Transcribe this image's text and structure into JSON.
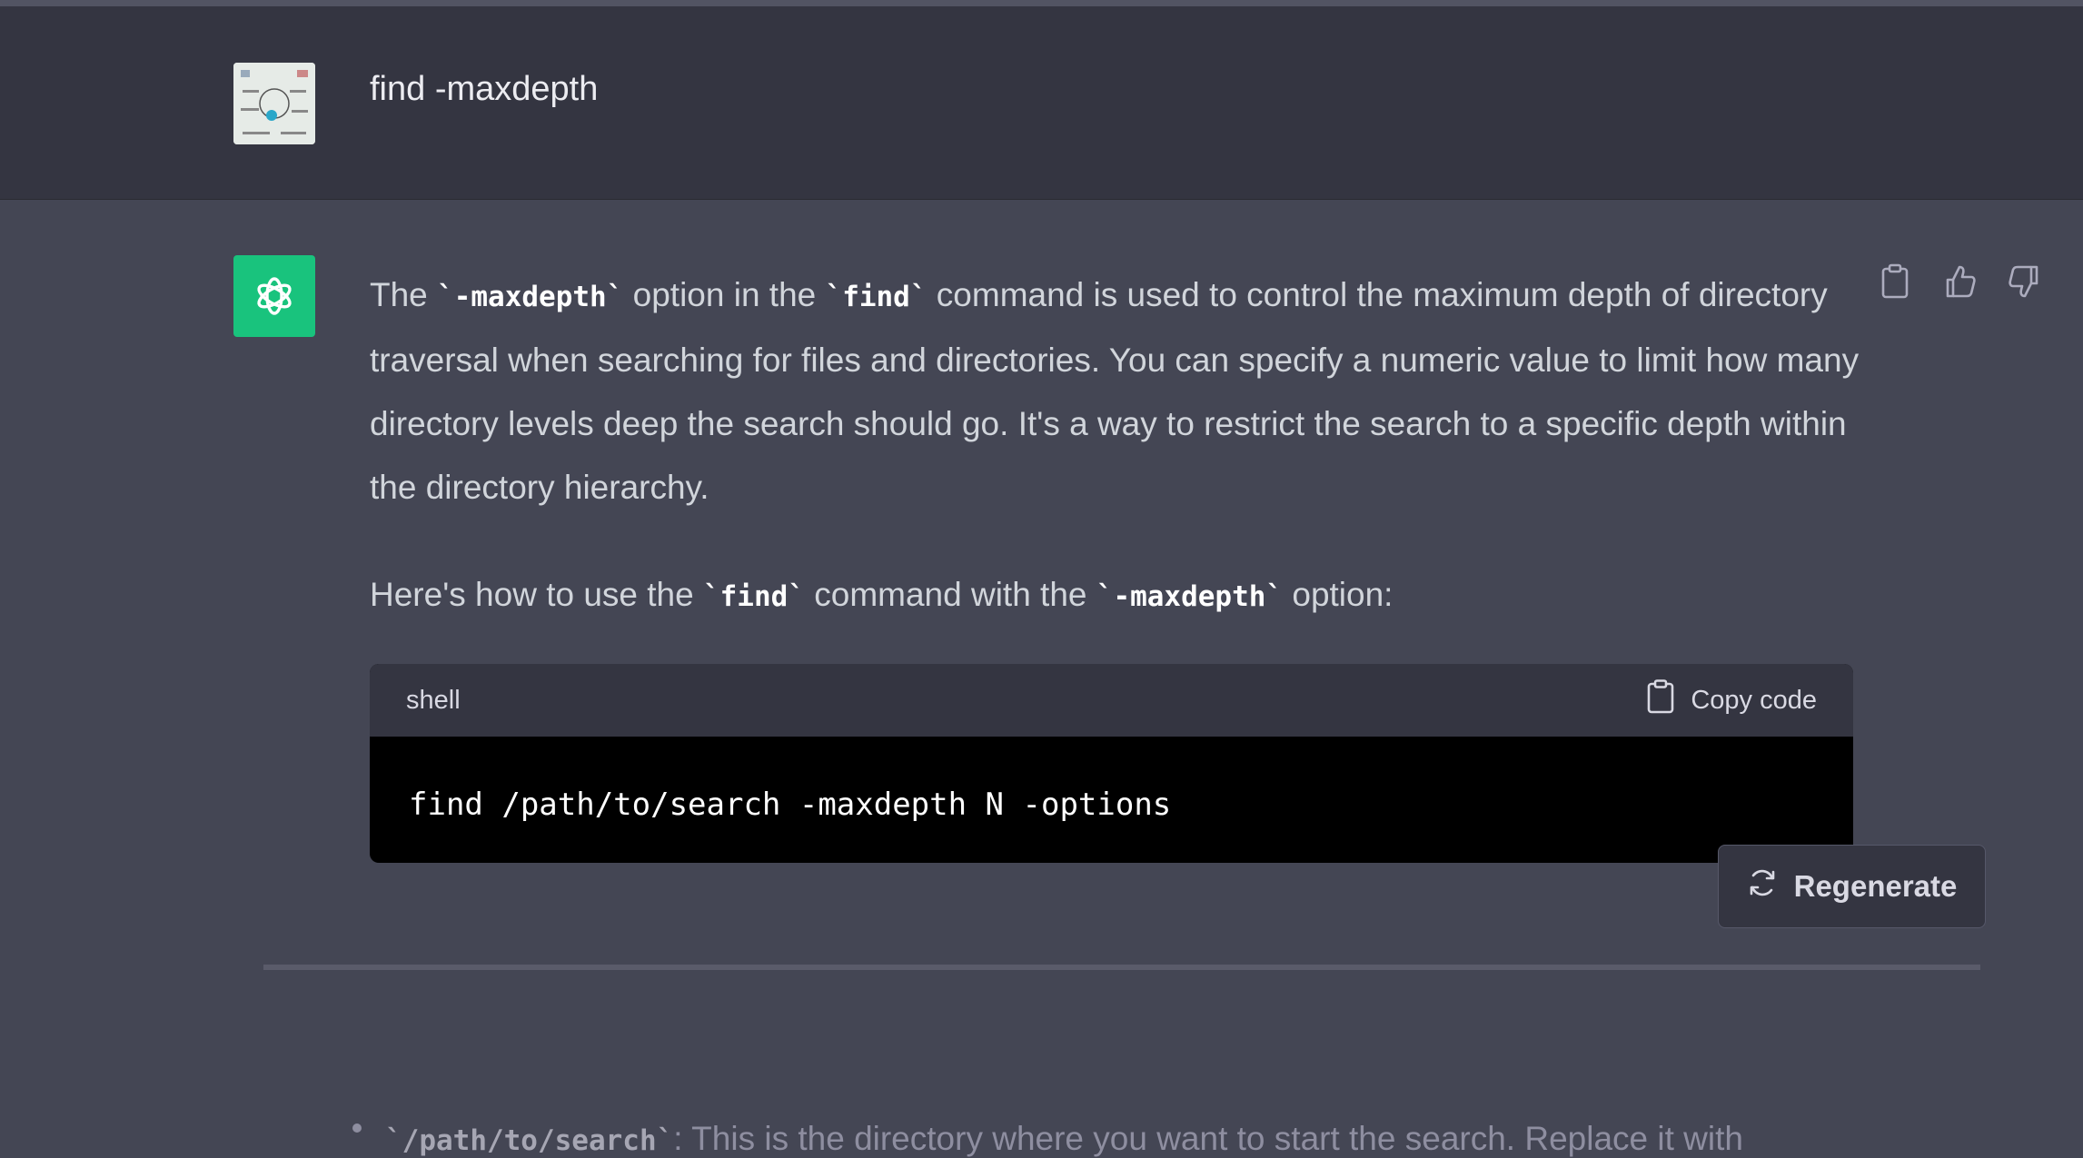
{
  "user_message": {
    "text": "find -maxdepth"
  },
  "assistant_message": {
    "p1": {
      "t1": "The ",
      "c1": "`-maxdepth`",
      "t2": " option in the ",
      "c2": "`find`",
      "t3": " command is used to control the maximum depth of directory traversal when searching for files and directories. You can specify a numeric value to limit how many directory levels deep the search should go. It's a way to restrict the search to a specific depth within the directory hierarchy."
    },
    "p2": {
      "t1": "Here's how to use the ",
      "c1": "`find`",
      "t2": " command with the ",
      "c2": "`-maxdepth`",
      "t3": " option:"
    },
    "code_block": {
      "language": "shell",
      "copy_label": "Copy code",
      "code": "find /path/to/search -maxdepth N -options"
    },
    "bullet": {
      "code": "`/path/to/search`",
      "text": ": This is the directory where you want to start the search. Replace it with"
    }
  },
  "regenerate_button": {
    "label": "Regenerate"
  },
  "icons": {
    "message_actions": [
      "clipboard-icon",
      "thumbs-up-icon",
      "thumbs-down-icon"
    ],
    "code_copy": "clipboard-icon",
    "regenerate": "refresh-icon",
    "assistant_avatar": "openai-logo-icon"
  },
  "colors": {
    "page_background": "#444654",
    "user_row_background": "#343541",
    "assistant_avatar_bg": "#19c37d",
    "code_background": "#000000",
    "code_header_background": "#343541"
  }
}
